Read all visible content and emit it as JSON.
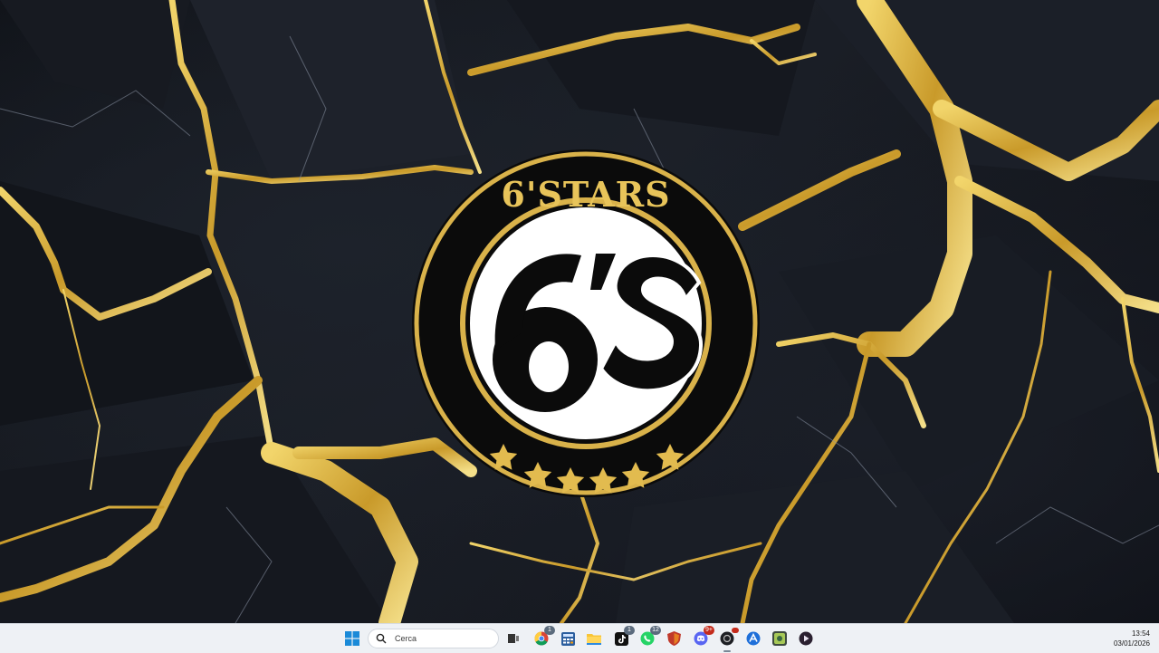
{
  "desktop": {
    "wallpaper": "black-gold-marble",
    "logo": {
      "title": "6'STARS",
      "mark": "6'S",
      "stars": 6,
      "colors": {
        "gold": "#d9b24a",
        "black": "#0b0b0b",
        "white": "#ffffff"
      }
    }
  },
  "taskbar": {
    "start_icon": "windows-start-icon",
    "search": {
      "placeholder": "Cerca"
    },
    "apps": [
      {
        "name": "task-view-icon"
      },
      {
        "name": "chrome-icon",
        "badge": "1"
      },
      {
        "name": "calculator-icon"
      },
      {
        "name": "file-explorer-icon"
      },
      {
        "name": "tiktok-icon",
        "badge": "1"
      },
      {
        "name": "whatsapp-icon",
        "badge": "12"
      },
      {
        "name": "app-shield-icon"
      },
      {
        "name": "discord-icon",
        "badge": "9+"
      },
      {
        "name": "app-dark-icon",
        "active": true
      },
      {
        "name": "app-blue-icon"
      },
      {
        "name": "app-photo-icon"
      },
      {
        "name": "media-player-icon"
      }
    ],
    "clock": {
      "time": "13:54",
      "date": "03/01/2026"
    }
  }
}
